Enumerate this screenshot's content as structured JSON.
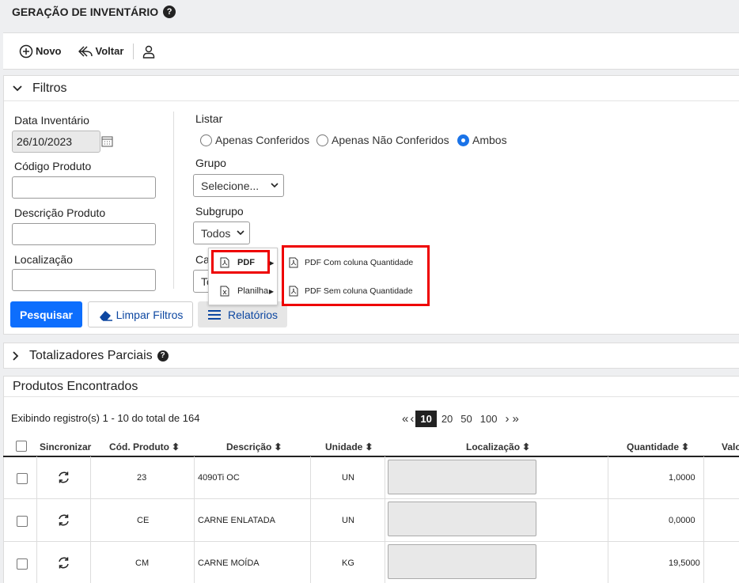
{
  "page": {
    "title": "GERAÇÃO DE INVENTÁRIO"
  },
  "toolbar": {
    "new_label": "Novo",
    "back_label": "Voltar"
  },
  "filters": {
    "header": "Filtros",
    "date_label": "Data Inventário",
    "date_value": "26/10/2023",
    "code_label": "Código Produto",
    "desc_label": "Descrição Produto",
    "loc_label": "Localização",
    "list_label": "Listar",
    "radio_only_checked": "Apenas Conferidos",
    "radio_only_unchecked": "Apenas Não Conferidos",
    "radio_both": "Ambos",
    "group_label": "Grupo",
    "group_value": "Selecione...",
    "subgroup_label": "Subgrupo",
    "subgroup_value": "Todos",
    "extra_label": "Ca",
    "extra_value": "To"
  },
  "actions": {
    "search": "Pesquisar",
    "clear": "Limpar Filtros",
    "reports": "Relatórios"
  },
  "menu": {
    "pdf": "PDF",
    "sheet": "Planilha",
    "pdf_with_qty": "PDF Com coluna Quantidade",
    "pdf_without_qty": "PDF Sem coluna Quantidade"
  },
  "totals": {
    "header": "Totalizadores Parciais"
  },
  "products": {
    "header": "Produtos Encontrados",
    "summary": "Exibindo registro(s) 1 - 10 do total de 164",
    "page_sizes": [
      "10",
      "20",
      "50",
      "100"
    ],
    "columns": {
      "sync": "Sincronizar",
      "code": "Cód. Produto",
      "desc": "Descrição",
      "unit": "Unidade",
      "loc": "Localização",
      "qty": "Quantidade",
      "val": "Valo"
    },
    "rows": [
      {
        "code": "23",
        "desc": "4090Ti OC",
        "unit": "UN",
        "qty": "1,0000"
      },
      {
        "code": "CE",
        "desc": "CARNE ENLATADA",
        "unit": "UN",
        "qty": "0,0000"
      },
      {
        "code": "CM",
        "desc": "CARNE MOÍDA",
        "unit": "KG",
        "qty": "19,5000"
      }
    ]
  }
}
